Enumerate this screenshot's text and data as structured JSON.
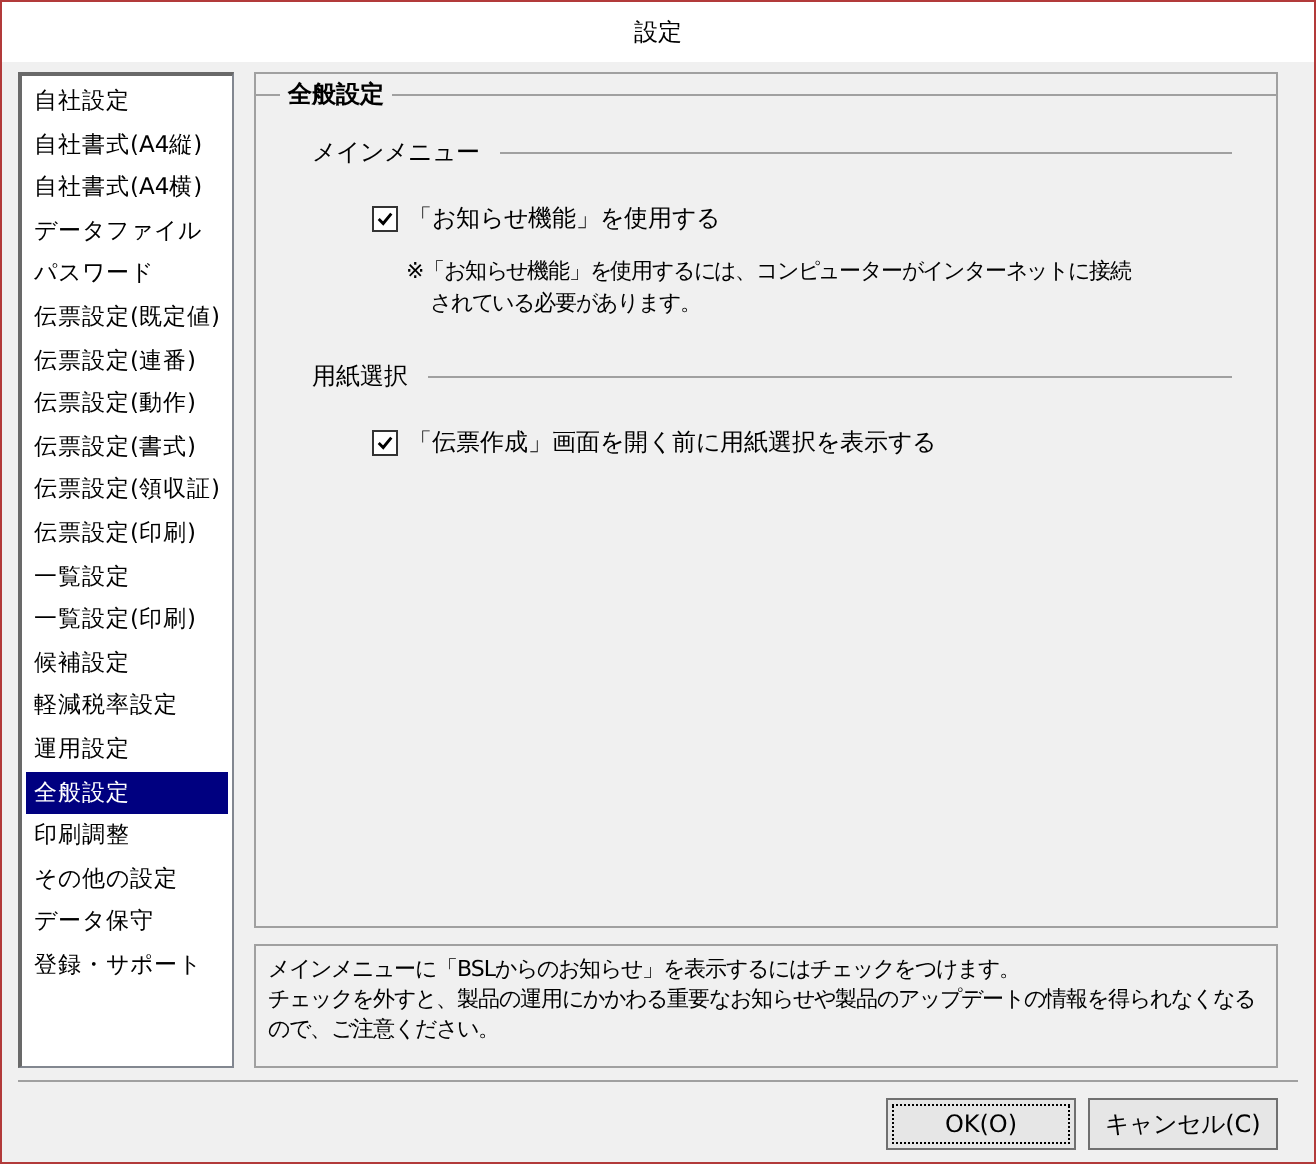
{
  "window": {
    "title": "設定"
  },
  "sidebar": {
    "items": [
      {
        "label": "自社設定",
        "selected": false
      },
      {
        "label": "自社書式(A4縦)",
        "selected": false
      },
      {
        "label": "自社書式(A4横)",
        "selected": false
      },
      {
        "label": "データファイル",
        "selected": false
      },
      {
        "label": "パスワード",
        "selected": false
      },
      {
        "label": "伝票設定(既定値)",
        "selected": false
      },
      {
        "label": "伝票設定(連番)",
        "selected": false
      },
      {
        "label": "伝票設定(動作)",
        "selected": false
      },
      {
        "label": "伝票設定(書式)",
        "selected": false
      },
      {
        "label": "伝票設定(領収証)",
        "selected": false
      },
      {
        "label": "伝票設定(印刷)",
        "selected": false
      },
      {
        "label": "一覧設定",
        "selected": false
      },
      {
        "label": "一覧設定(印刷)",
        "selected": false
      },
      {
        "label": "候補設定",
        "selected": false
      },
      {
        "label": "軽減税率設定",
        "selected": false
      },
      {
        "label": "運用設定",
        "selected": false
      },
      {
        "label": "全般設定",
        "selected": true
      },
      {
        "label": "印刷調整",
        "selected": false
      },
      {
        "label": "その他の設定",
        "selected": false
      },
      {
        "label": "データ保守",
        "selected": false
      },
      {
        "label": "登録・サポート",
        "selected": false
      }
    ]
  },
  "panel": {
    "title": "全般設定",
    "sections": [
      {
        "heading": "メインメニュー",
        "option": {
          "label": "「お知らせ機能」を使用する",
          "checked": true
        },
        "note": [
          "※「お知らせ機能」を使用するには、コンピューターがインターネットに接続",
          "されている必要があります。"
        ]
      },
      {
        "heading": "用紙選択",
        "option": {
          "label": "「伝票作成」画面を開く前に用紙選択を表示する",
          "checked": true
        }
      }
    ]
  },
  "description": [
    "メインメニューに「BSLからのお知らせ」を表示するにはチェックをつけます。",
    "チェックを外すと、製品の運用にかかわる重要なお知らせや製品のアップデートの情報を得られなくなるので、ご注意ください。"
  ],
  "buttons": [
    "OK(O)",
    "キャンセル(C)"
  ]
}
